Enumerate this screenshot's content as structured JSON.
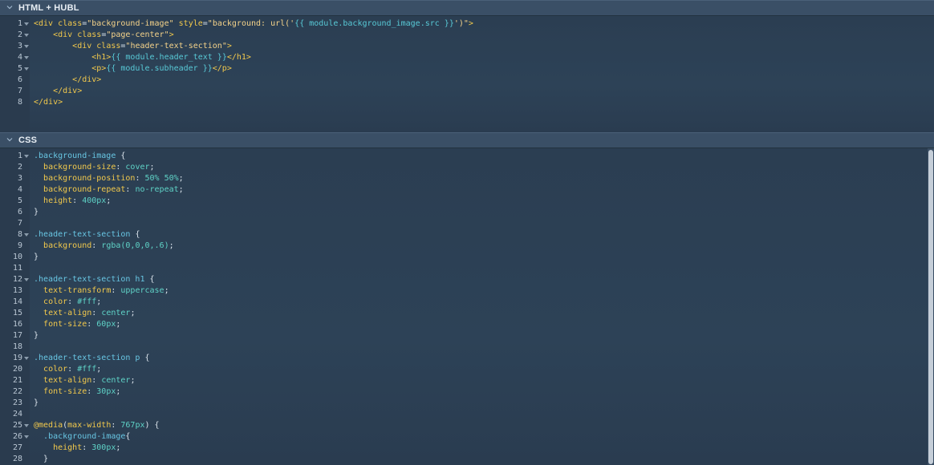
{
  "panels": [
    {
      "title": "HTML + HUBL",
      "lines": [
        {
          "n": "1",
          "fold": true,
          "tokens": [
            [
              "t-tag",
              "<div "
            ],
            [
              "t-attr",
              "class"
            ],
            [
              "t-plain",
              "="
            ],
            [
              "t-str",
              "\"background-image\""
            ],
            [
              "t-plain",
              " "
            ],
            [
              "t-attr",
              "style"
            ],
            [
              "t-plain",
              "="
            ],
            [
              "t-str",
              "\"background: url('"
            ],
            [
              "t-hubl",
              "{{ module.background_image.src }}"
            ],
            [
              "t-str",
              "')\""
            ],
            [
              "t-tag",
              ">"
            ]
          ]
        },
        {
          "n": "2",
          "fold": true,
          "tokens": [
            [
              "t-plain",
              "    "
            ],
            [
              "t-tag",
              "<div "
            ],
            [
              "t-attr",
              "class"
            ],
            [
              "t-plain",
              "="
            ],
            [
              "t-str",
              "\"page-center\""
            ],
            [
              "t-tag",
              ">"
            ]
          ]
        },
        {
          "n": "3",
          "fold": true,
          "tokens": [
            [
              "t-plain",
              "        "
            ],
            [
              "t-tag",
              "<div "
            ],
            [
              "t-attr",
              "class"
            ],
            [
              "t-plain",
              "="
            ],
            [
              "t-str",
              "\"header-text-section\""
            ],
            [
              "t-tag",
              ">"
            ]
          ]
        },
        {
          "n": "4",
          "fold": true,
          "tokens": [
            [
              "t-plain",
              "            "
            ],
            [
              "t-tag",
              "<h1>"
            ],
            [
              "t-hubl",
              "{{ module.header_text }}"
            ],
            [
              "t-tag",
              "</h1>"
            ]
          ]
        },
        {
          "n": "5",
          "fold": true,
          "tokens": [
            [
              "t-plain",
              "            "
            ],
            [
              "t-tag",
              "<p>"
            ],
            [
              "t-hubl",
              "{{ module.subheader }}"
            ],
            [
              "t-tag",
              "</p>"
            ]
          ]
        },
        {
          "n": "6",
          "fold": false,
          "tokens": [
            [
              "t-plain",
              "        "
            ],
            [
              "t-tag",
              "</div>"
            ]
          ]
        },
        {
          "n": "7",
          "fold": false,
          "tokens": [
            [
              "t-plain",
              "    "
            ],
            [
              "t-tag",
              "</div>"
            ]
          ]
        },
        {
          "n": "8",
          "fold": false,
          "tokens": [
            [
              "t-tag",
              "</div>"
            ]
          ]
        }
      ]
    },
    {
      "title": "CSS",
      "lines": [
        {
          "n": "1",
          "fold": true,
          "tokens": [
            [
              "t-sel",
              ".background-image"
            ],
            [
              "t-plain",
              " {"
            ]
          ]
        },
        {
          "n": "2",
          "fold": false,
          "tokens": [
            [
              "t-plain",
              "  "
            ],
            [
              "t-prop",
              "background-size"
            ],
            [
              "t-plain",
              ": "
            ],
            [
              "t-val",
              "cover"
            ],
            [
              "t-plain",
              ";"
            ]
          ]
        },
        {
          "n": "3",
          "fold": false,
          "tokens": [
            [
              "t-plain",
              "  "
            ],
            [
              "t-prop",
              "background-position"
            ],
            [
              "t-plain",
              ": "
            ],
            [
              "t-val",
              "50% 50%"
            ],
            [
              "t-plain",
              ";"
            ]
          ]
        },
        {
          "n": "4",
          "fold": false,
          "tokens": [
            [
              "t-plain",
              "  "
            ],
            [
              "t-prop",
              "background-repeat"
            ],
            [
              "t-plain",
              ": "
            ],
            [
              "t-val",
              "no-repeat"
            ],
            [
              "t-plain",
              ";"
            ]
          ]
        },
        {
          "n": "5",
          "fold": false,
          "tokens": [
            [
              "t-plain",
              "  "
            ],
            [
              "t-prop",
              "height"
            ],
            [
              "t-plain",
              ": "
            ],
            [
              "t-val",
              "400px"
            ],
            [
              "t-plain",
              ";"
            ]
          ]
        },
        {
          "n": "6",
          "fold": false,
          "tokens": [
            [
              "t-plain",
              "}"
            ]
          ]
        },
        {
          "n": "7",
          "fold": false,
          "tokens": []
        },
        {
          "n": "8",
          "fold": true,
          "tokens": [
            [
              "t-sel",
              ".header-text-section"
            ],
            [
              "t-plain",
              " {"
            ]
          ]
        },
        {
          "n": "9",
          "fold": false,
          "tokens": [
            [
              "t-plain",
              "  "
            ],
            [
              "t-prop",
              "background"
            ],
            [
              "t-plain",
              ": "
            ],
            [
              "t-val",
              "rgba(0,0,0,.6)"
            ],
            [
              "t-plain",
              ";"
            ]
          ]
        },
        {
          "n": "10",
          "fold": false,
          "tokens": [
            [
              "t-plain",
              "}"
            ]
          ]
        },
        {
          "n": "11",
          "fold": false,
          "tokens": []
        },
        {
          "n": "12",
          "fold": true,
          "tokens": [
            [
              "t-sel",
              ".header-text-section h1"
            ],
            [
              "t-plain",
              " {"
            ]
          ]
        },
        {
          "n": "13",
          "fold": false,
          "tokens": [
            [
              "t-plain",
              "  "
            ],
            [
              "t-prop",
              "text-transform"
            ],
            [
              "t-plain",
              ": "
            ],
            [
              "t-val",
              "uppercase"
            ],
            [
              "t-plain",
              ";"
            ]
          ]
        },
        {
          "n": "14",
          "fold": false,
          "tokens": [
            [
              "t-plain",
              "  "
            ],
            [
              "t-prop",
              "color"
            ],
            [
              "t-plain",
              ": "
            ],
            [
              "t-val",
              "#fff"
            ],
            [
              "t-plain",
              ";"
            ]
          ]
        },
        {
          "n": "15",
          "fold": false,
          "tokens": [
            [
              "t-plain",
              "  "
            ],
            [
              "t-prop",
              "text-align"
            ],
            [
              "t-plain",
              ": "
            ],
            [
              "t-val",
              "center"
            ],
            [
              "t-plain",
              ";"
            ]
          ]
        },
        {
          "n": "16",
          "fold": false,
          "tokens": [
            [
              "t-plain",
              "  "
            ],
            [
              "t-prop",
              "font-size"
            ],
            [
              "t-plain",
              ": "
            ],
            [
              "t-val",
              "60px"
            ],
            [
              "t-plain",
              ";"
            ]
          ]
        },
        {
          "n": "17",
          "fold": false,
          "tokens": [
            [
              "t-plain",
              "}"
            ]
          ]
        },
        {
          "n": "18",
          "fold": false,
          "tokens": []
        },
        {
          "n": "19",
          "fold": true,
          "tokens": [
            [
              "t-sel",
              ".header-text-section p"
            ],
            [
              "t-plain",
              " {"
            ]
          ]
        },
        {
          "n": "20",
          "fold": false,
          "tokens": [
            [
              "t-plain",
              "  "
            ],
            [
              "t-prop",
              "color"
            ],
            [
              "t-plain",
              ": "
            ],
            [
              "t-val",
              "#fff"
            ],
            [
              "t-plain",
              ";"
            ]
          ]
        },
        {
          "n": "21",
          "fold": false,
          "tokens": [
            [
              "t-plain",
              "  "
            ],
            [
              "t-prop",
              "text-align"
            ],
            [
              "t-plain",
              ": "
            ],
            [
              "t-val",
              "center"
            ],
            [
              "t-plain",
              ";"
            ]
          ]
        },
        {
          "n": "22",
          "fold": false,
          "tokens": [
            [
              "t-plain",
              "  "
            ],
            [
              "t-prop",
              "font-size"
            ],
            [
              "t-plain",
              ": "
            ],
            [
              "t-val",
              "30px"
            ],
            [
              "t-plain",
              ";"
            ]
          ]
        },
        {
          "n": "23",
          "fold": false,
          "tokens": [
            [
              "t-plain",
              "}"
            ]
          ]
        },
        {
          "n": "24",
          "fold": false,
          "tokens": []
        },
        {
          "n": "25",
          "fold": true,
          "tokens": [
            [
              "t-at",
              "@media"
            ],
            [
              "t-plain",
              "("
            ],
            [
              "t-prop",
              "max-width"
            ],
            [
              "t-plain",
              ": "
            ],
            [
              "t-val",
              "767px"
            ],
            [
              "t-plain",
              ") {"
            ]
          ]
        },
        {
          "n": "26",
          "fold": true,
          "tokens": [
            [
              "t-plain",
              "  "
            ],
            [
              "t-sel",
              ".background-image"
            ],
            [
              "t-plain",
              "{"
            ]
          ]
        },
        {
          "n": "27",
          "fold": false,
          "tokens": [
            [
              "t-plain",
              "    "
            ],
            [
              "t-prop",
              "height"
            ],
            [
              "t-plain",
              ": "
            ],
            [
              "t-val",
              "300px"
            ],
            [
              "t-plain",
              ";"
            ]
          ]
        },
        {
          "n": "28",
          "fold": false,
          "tokens": [
            [
              "t-plain",
              "  }"
            ]
          ]
        }
      ]
    }
  ]
}
